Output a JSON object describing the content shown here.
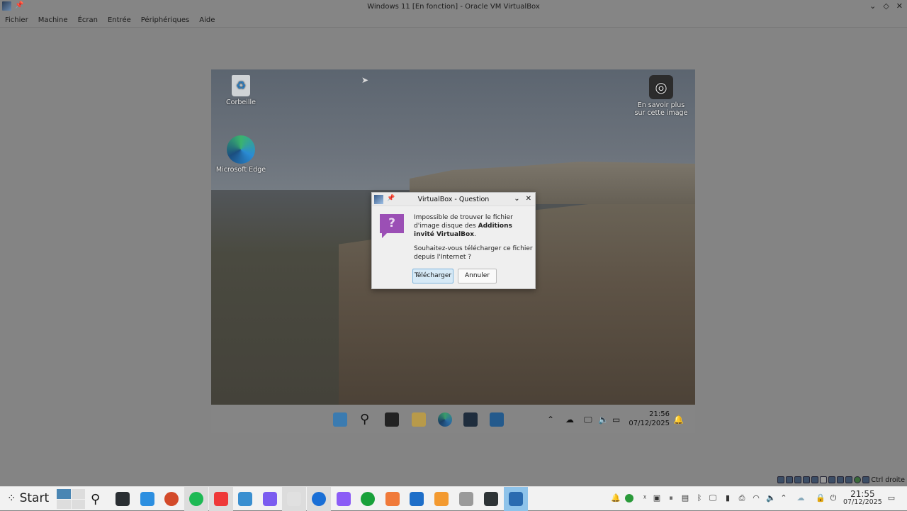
{
  "window": {
    "title": "Windows 11 [En fonction] - Oracle VM VirtualBox",
    "controls": [
      "minimize",
      "maximize",
      "close"
    ]
  },
  "menu": [
    "Fichier",
    "Machine",
    "Écran",
    "Entrée",
    "Périphériques",
    "Aide"
  ],
  "guest": {
    "desktop_icons": [
      {
        "label": "Corbeille",
        "icon": "recycle-bin-icon"
      },
      {
        "label": "Microsoft Edge",
        "icon": "edge-icon"
      },
      {
        "label": "En savoir plus sur cette image",
        "icon": "image-info-icon"
      }
    ],
    "taskbar": {
      "apps": [
        "windows-start",
        "search",
        "task-view",
        "file-explorer",
        "edge",
        "store",
        "outlook"
      ],
      "time": "21:56",
      "date": "07/12/2025"
    }
  },
  "dialog": {
    "title": "VirtualBox - Question",
    "message_pre": "Impossible de trouver le fichier d'image disque des ",
    "message_bold": "Additions invité VirtualBox",
    "message_post": ".",
    "question": "Souhaitez-vous télécharger ce fichier depuis l'Internet ?",
    "primary_button": "Télécharger",
    "cancel_button": "Annuler"
  },
  "statusbar": {
    "host_key": "Ctrl droite"
  },
  "host_taskbar": {
    "start_label": "Start",
    "apps": [
      {
        "name": "search",
        "color": "#ffffff"
      },
      {
        "name": "system-settings",
        "color": "#2a2f33"
      },
      {
        "name": "discover-store",
        "color": "#2d8fe0"
      },
      {
        "name": "aperture",
        "color": "#d34a2a"
      },
      {
        "name": "spotify",
        "color": "#1db954"
      },
      {
        "name": "vivaldi",
        "color": "#ef3939"
      },
      {
        "name": "files",
        "color": "#3a8fd0"
      },
      {
        "name": "proton-vpn",
        "color": "#7b5cf0"
      },
      {
        "name": "document",
        "color": "#e0e0e0"
      },
      {
        "name": "thunderbird",
        "color": "#1a6fd6"
      },
      {
        "name": "proton-mail",
        "color": "#8b5cf6"
      },
      {
        "name": "whatsapp-like",
        "color": "#19a13a"
      },
      {
        "name": "layers",
        "color": "#f07a3a"
      },
      {
        "name": "libreoffice-writer",
        "color": "#1e6ec8"
      },
      {
        "name": "bitwarden-b",
        "color": "#f39a30"
      },
      {
        "name": "calculator",
        "color": "#9a9a9a"
      },
      {
        "name": "terminal",
        "color": "#2e3436"
      },
      {
        "name": "virtualbox",
        "color": "#2a6bb0"
      }
    ],
    "time": "21:55",
    "date": "07/12/2025"
  }
}
